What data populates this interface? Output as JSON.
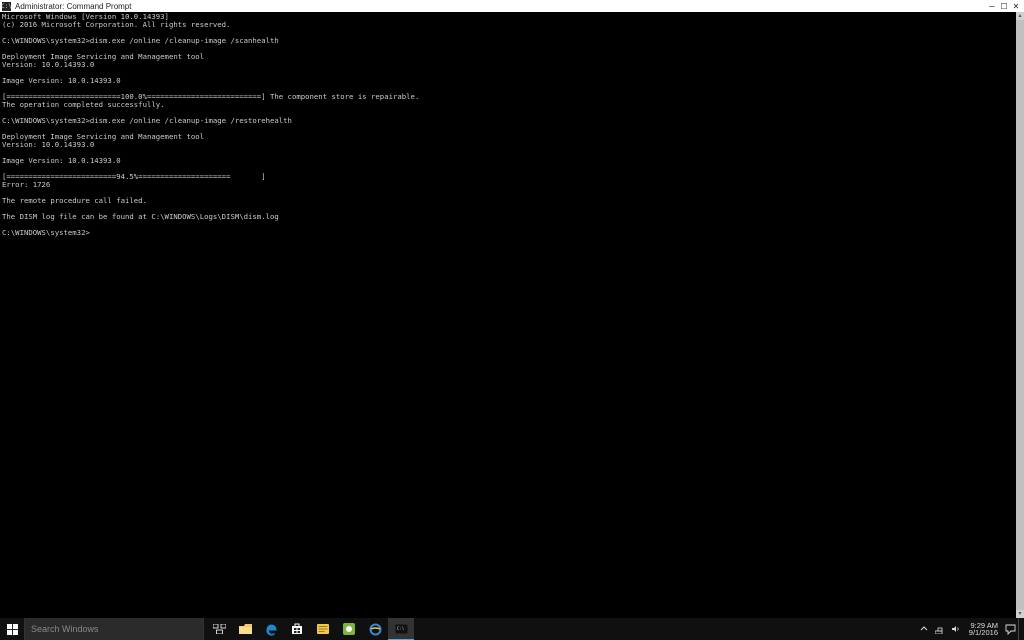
{
  "window": {
    "title": "Administrator: Command Prompt"
  },
  "terminal": {
    "lines": [
      "Microsoft Windows [Version 10.0.14393]",
      "(c) 2016 Microsoft Corporation. All rights reserved.",
      "",
      "C:\\WINDOWS\\system32>dism.exe /online /cleanup-image /scanhealth",
      "",
      "Deployment Image Servicing and Management tool",
      "Version: 10.0.14393.0",
      "",
      "Image Version: 10.0.14393.0",
      "",
      "[==========================100.0%==========================] The component store is repairable.",
      "The operation completed successfully.",
      "",
      "C:\\WINDOWS\\system32>dism.exe /online /cleanup-image /restorehealth",
      "",
      "Deployment Image Servicing and Management tool",
      "Version: 10.0.14393.0",
      "",
      "Image Version: 10.0.14393.0",
      "",
      "[=========================94.5%=====================       ]",
      "Error: 1726",
      "",
      "The remote procedure call failed.",
      "",
      "The DISM log file can be found at C:\\WINDOWS\\Logs\\DISM\\dism.log",
      "",
      "C:\\WINDOWS\\system32>"
    ]
  },
  "taskbar": {
    "search_placeholder": "Search Windows",
    "time": "9:29 AM",
    "date": "9/1/2016"
  }
}
